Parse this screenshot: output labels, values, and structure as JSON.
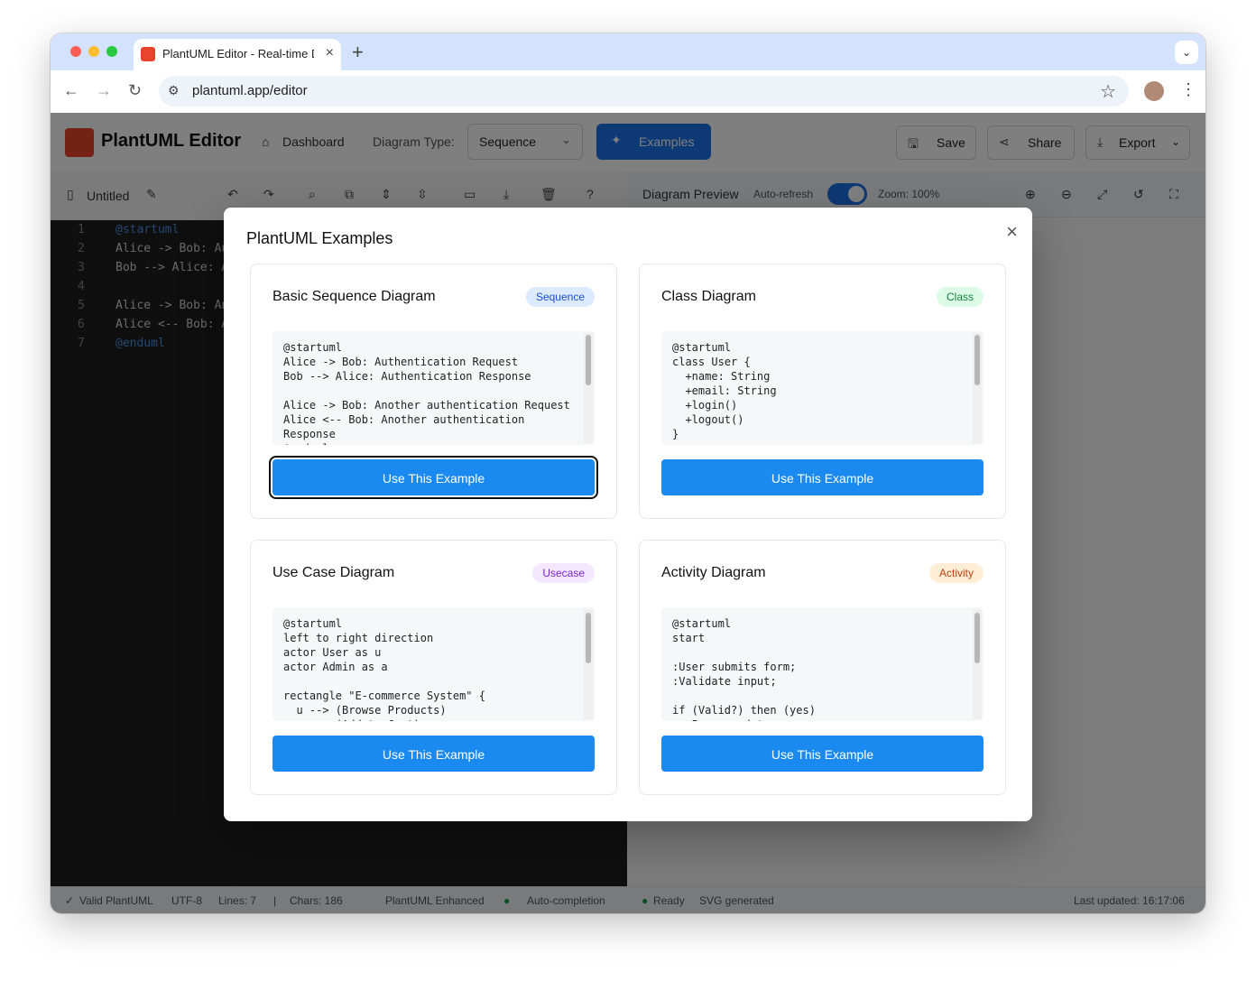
{
  "browser": {
    "tab_title": "PlantUML Editor - Real-time Diagrams",
    "url": "plantuml.app/editor",
    "new_tab": "+"
  },
  "header": {
    "brand": "PlantUML Editor",
    "dashboard": "Dashboard",
    "diagram_type_label": "Diagram Type:",
    "diagram_type_value": "Sequence",
    "examples": "Examples",
    "save": "Save",
    "share": "Share",
    "export": "Export"
  },
  "editor": {
    "filename": "Untitled",
    "lines": [
      {
        "n": "1",
        "text": "@startuml"
      },
      {
        "n": "2",
        "text": "Alice -> Bob: Authentication Request"
      },
      {
        "n": "3",
        "text": "Bob --> Alice: Authentication Response"
      },
      {
        "n": "4",
        "text": ""
      },
      {
        "n": "5",
        "text": "Alice -> Bob: Another authentication Request"
      },
      {
        "n": "6",
        "text": "Alice <-- Bob: Another authentication Response"
      },
      {
        "n": "7",
        "text": "@enduml"
      }
    ]
  },
  "preview": {
    "title": "Diagram Preview",
    "auto_refresh": "Auto-refresh",
    "zoom": "Zoom: 100%"
  },
  "status": {
    "valid": "Valid PlantUML",
    "encoding": "UTF-8",
    "lines": "Lines: 7",
    "sep": "|",
    "chars": "Chars: 186",
    "mode": "PlantUML Enhanced",
    "autocomplete": "Auto-completion",
    "ready": "Ready",
    "svg": "SVG generated",
    "updated": "Last updated: 16:17:06"
  },
  "modal": {
    "title": "PlantUML Examples",
    "close": "×",
    "cards": [
      {
        "title": "Basic Sequence Diagram",
        "badge": "Sequence",
        "badge_bg": "#dbeafe",
        "badge_fg": "#1d4ed8",
        "code": "@startuml\nAlice -> Bob: Authentication Request\nBob --> Alice: Authentication Response\n\nAlice -> Bob: Another authentication Request\nAlice <-- Bob: Another authentication\nResponse\n@enduml",
        "button": "Use This Example"
      },
      {
        "title": "Class Diagram",
        "badge": "Class",
        "badge_bg": "#dcfce7",
        "badge_fg": "#15803d",
        "code": "@startuml\nclass User {\n  +name: String\n  +email: String\n  +login()\n  +logout()\n}",
        "button": "Use This Example"
      },
      {
        "title": "Use Case Diagram",
        "badge": "Usecase",
        "badge_bg": "#f3e8ff",
        "badge_fg": "#7e22ce",
        "code": "@startuml\nleft to right direction\nactor User as u\nactor Admin as a\n\nrectangle \"E-commerce System\" {\n  u --> (Browse Products)\n  u --> (Add to Cart)",
        "button": "Use This Example"
      },
      {
        "title": "Activity Diagram",
        "badge": "Activity",
        "badge_bg": "#ffedd5",
        "badge_fg": "#c2410c",
        "code": "@startuml\nstart\n\n:User submits form;\n:Validate input;\n\nif (Valid?) then (yes)\n  :Process data;",
        "button": "Use This Example"
      }
    ]
  }
}
